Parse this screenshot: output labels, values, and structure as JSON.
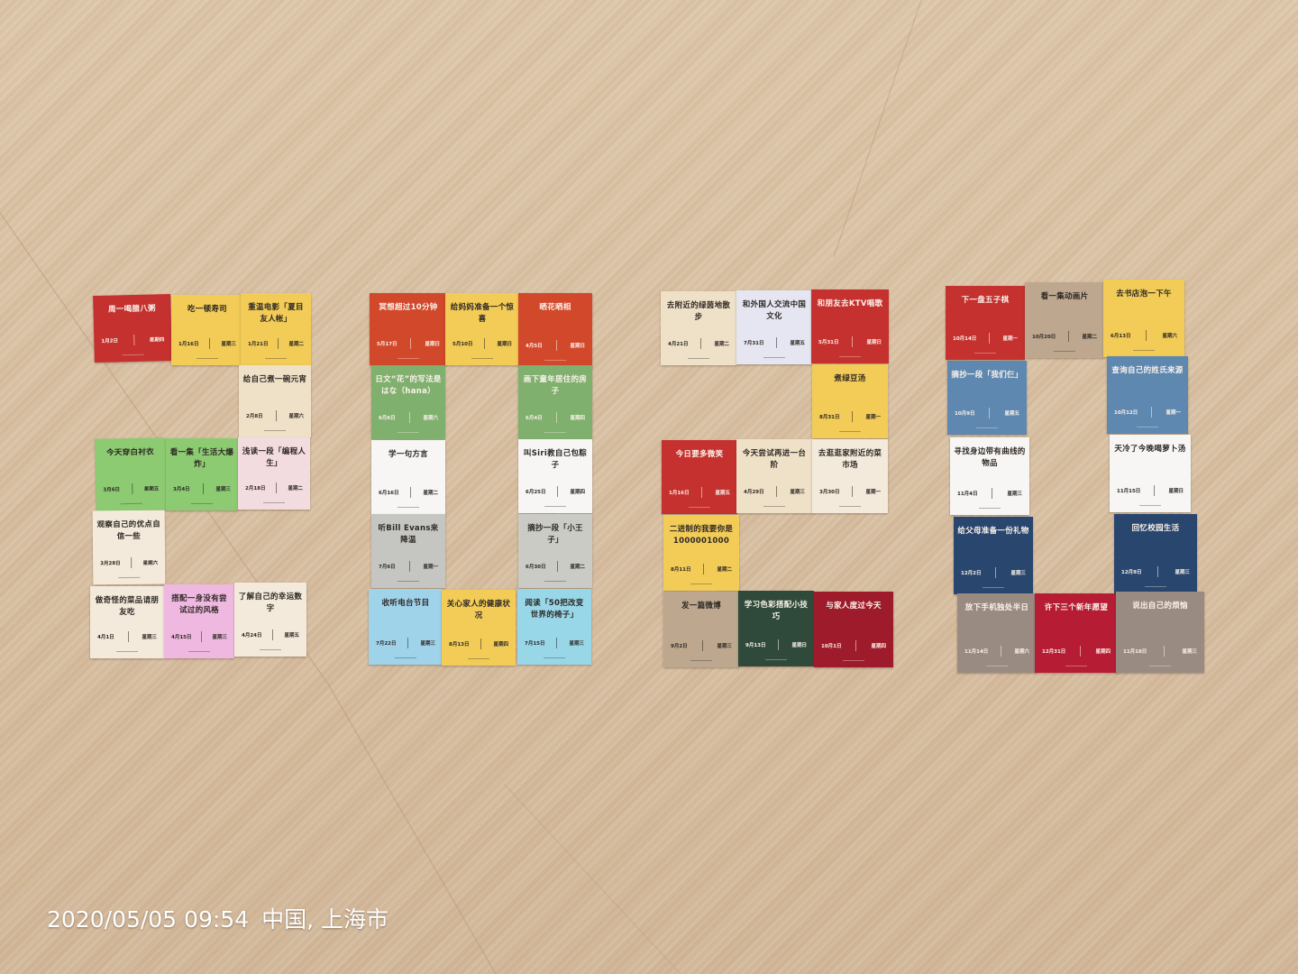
{
  "watermark": {
    "datetime": "2020/05/05 09:54",
    "location": "中国, 上海市"
  },
  "palette": {
    "red": "#c5312f",
    "yellow": "#f2cc57",
    "cream": "#efe1c8",
    "light_cream": "#f3eadb",
    "green": "#8ccb72",
    "pink": "#f3dce0",
    "lavender": "#efb8e0",
    "orange_red": "#d2482b",
    "sage": "#7fb06e",
    "white": "#f7f6f4",
    "gray": "#c5c6c1",
    "gray_green": "#c9cbc4",
    "light_blue": "#9fd3ea",
    "cyan": "#98d7e8",
    "lilac": "#e6e6f3",
    "dark_green": "#2f4a3a",
    "maroon": "#9e1b2b",
    "tan": "#bda88f",
    "steel_blue": "#5e88b0",
    "navy": "#28466e",
    "taupe": "#9a8b82",
    "crimson": "#b61d34"
  },
  "cards": [
    {
      "title": "周一喝腊八粥",
      "date": "1月2日",
      "weekday": "星期四",
      "color": "red"
    },
    {
      "title": "吃一顿寿司",
      "date": "1月16日",
      "weekday": "星期三",
      "color": "yellow"
    },
    {
      "title": "重温电影「夏目友人帐」",
      "date": "1月21日",
      "weekday": "星期二",
      "color": "yellow"
    },
    {
      "title": "给自己煮一碗元宵",
      "date": "2月8日",
      "weekday": "星期六",
      "color": "cream"
    },
    {
      "title": "今天穿白衬衣",
      "date": "3月6日",
      "weekday": "星期五",
      "color": "green"
    },
    {
      "title": "看一集「生活大爆炸」",
      "date": "3月4日",
      "weekday": "星期三",
      "color": "green"
    },
    {
      "title": "浅读一段「编程人生」",
      "date": "2月18日",
      "weekday": "星期二",
      "color": "pink"
    },
    {
      "title": "观察自己的优点自信一些",
      "date": "3月28日",
      "weekday": "星期六",
      "color": "light_cream"
    },
    {
      "title": "做奇怪的菜品请朋友吃",
      "date": "4月1日",
      "weekday": "星期三",
      "color": "light_cream"
    },
    {
      "title": "搭配一身没有尝试过的风格",
      "date": "4月15日",
      "weekday": "星期三",
      "color": "lavender"
    },
    {
      "title": "了解自己的幸运数字",
      "date": "4月24日",
      "weekday": "星期五",
      "color": "light_cream"
    },
    {
      "title": "冥想超过10分钟",
      "date": "5月17日",
      "weekday": "星期日",
      "color": "orange_red"
    },
    {
      "title": "给妈妈准备一个惊喜",
      "date": "5月10日",
      "weekday": "星期日",
      "color": "yellow"
    },
    {
      "title": "晒花晒相",
      "date": "4月5日",
      "weekday": "星期日",
      "color": "orange_red"
    },
    {
      "title": "日文“花”的写法是はな（hana）",
      "date": "6月6日",
      "weekday": "星期六",
      "color": "sage"
    },
    {
      "title": "画下童年居住的房子",
      "date": "6月4日",
      "weekday": "星期四",
      "color": "sage"
    },
    {
      "title": "学一句方言",
      "date": "6月16日",
      "weekday": "星期二",
      "color": "white"
    },
    {
      "title": "叫Siri教自己包粽子",
      "date": "6月25日",
      "weekday": "星期四",
      "color": "white"
    },
    {
      "title": "听Bill Evans来降温",
      "date": "7月6日",
      "weekday": "星期一",
      "color": "gray"
    },
    {
      "title": "摘抄一段「小王子」",
      "date": "6月30日",
      "weekday": "星期二",
      "color": "gray_green"
    },
    {
      "title": "收听电台节目",
      "date": "7月22日",
      "weekday": "星期三",
      "color": "light_blue"
    },
    {
      "title": "关心家人的健康状况",
      "date": "8月13日",
      "weekday": "星期四",
      "color": "yellow"
    },
    {
      "title": "阅读「50把改变世界的椅子」",
      "date": "7月15日",
      "weekday": "星期三",
      "color": "cyan"
    },
    {
      "title": "去附近的绿茵地散步",
      "date": "4月21日",
      "weekday": "星期二",
      "color": "cream"
    },
    {
      "title": "和外国人交流中国文化",
      "date": "7月31日",
      "weekday": "星期五",
      "color": "lilac"
    },
    {
      "title": "和朋友去KTV唱歌",
      "date": "5月31日",
      "weekday": "星期日",
      "color": "red"
    },
    {
      "title": "煮绿豆汤",
      "date": "8月31日",
      "weekday": "星期一",
      "color": "yellow"
    },
    {
      "title": "今日要多微笑",
      "date": "1月16日",
      "weekday": "星期五",
      "color": "red"
    },
    {
      "title": "今天尝试再进一台阶",
      "date": "4月29日",
      "weekday": "星期三",
      "color": "cream"
    },
    {
      "title": "去逛逛家附近的菜市场",
      "date": "3月30日",
      "weekday": "星期一",
      "color": "light_cream"
    },
    {
      "title": "二进制的我要你是1000001000",
      "date": "8月11日",
      "weekday": "星期二",
      "color": "yellow"
    },
    {
      "title": "发一篇微博",
      "date": "9月2日",
      "weekday": "星期三",
      "color": "tan"
    },
    {
      "title": "学习色彩搭配小技巧",
      "date": "9月13日",
      "weekday": "星期日",
      "color": "dark_green"
    },
    {
      "title": "与家人度过今天",
      "date": "10月1日",
      "weekday": "星期四",
      "color": "maroon"
    },
    {
      "title": "下一盘五子棋",
      "date": "10月14日",
      "weekday": "星期一",
      "color": "red"
    },
    {
      "title": "看一集动画片",
      "date": "10月20日",
      "weekday": "星期二",
      "color": "tan"
    },
    {
      "title": "去书店泡一下午",
      "date": "6月13日",
      "weekday": "星期六",
      "color": "yellow"
    },
    {
      "title": "摘抄一段「我们仨」",
      "date": "10月9日",
      "weekday": "星期五",
      "color": "steel_blue"
    },
    {
      "title": "查询自己的姓氏来源",
      "date": "10月12日",
      "weekday": "星期一",
      "color": "steel_blue"
    },
    {
      "title": "寻找身边带有曲线的物品",
      "date": "11月4日",
      "weekday": "星期三",
      "color": "white"
    },
    {
      "title": "天冷了今晚喝萝卜汤",
      "date": "11月15日",
      "weekday": "星期日",
      "color": "white"
    },
    {
      "title": "给父母准备一份礼物",
      "date": "12月2日",
      "weekday": "星期三",
      "color": "navy"
    },
    {
      "title": "回忆校园生活",
      "date": "12月9日",
      "weekday": "星期三",
      "color": "navy"
    },
    {
      "title": "放下手机独处半日",
      "date": "11月14日",
      "weekday": "星期六",
      "color": "taupe"
    },
    {
      "title": "许下三个新年愿望",
      "date": "12月31日",
      "weekday": "星期四",
      "color": "crimson"
    },
    {
      "title": "说出自己的烦恼",
      "date": "11月18日",
      "weekday": "星期三",
      "color": "taupe"
    }
  ]
}
